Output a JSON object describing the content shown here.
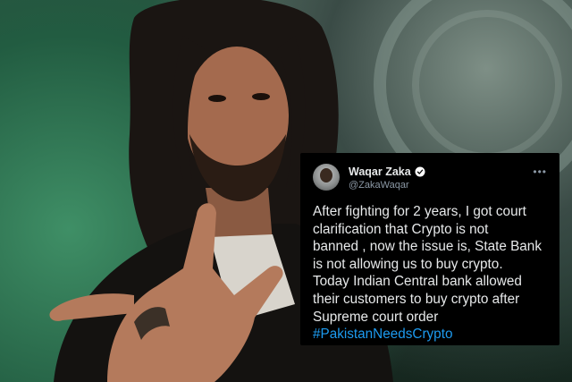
{
  "tweet": {
    "display_name": "Waqar Zaka",
    "handle": "@ZakaWaqar",
    "more_icon": "ellipsis-icon",
    "verified_icon": "verified-badge-icon",
    "body_lines": [
      "After fighting for 2 years, I got court",
      "clarification that Crypto is not",
      "banned , now the issue is, State Bank",
      "is not allowing us to buy crypto.",
      "Today Indian Central bank allowed",
      "their customers to buy crypto after",
      "Supreme court order"
    ],
    "hashtag": "#PakistanNeedsCrypto"
  },
  "colors": {
    "card_bg": "#000000",
    "text": "#e7e9ea",
    "muted": "#8b98a5",
    "link": "#1d9bf0",
    "verified": "#ffffff"
  }
}
